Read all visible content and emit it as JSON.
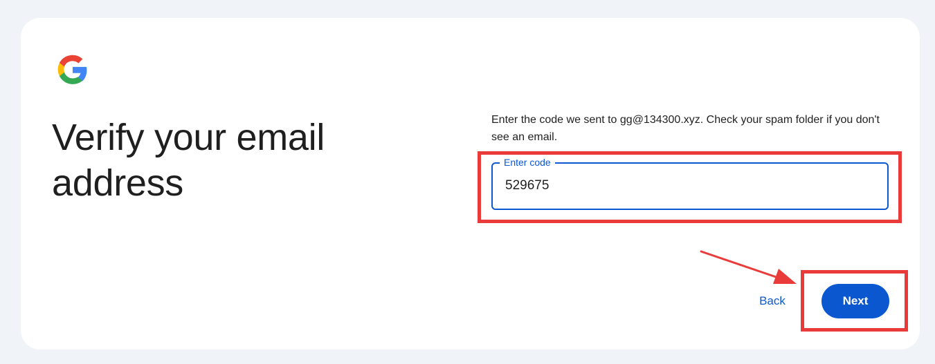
{
  "logo": {
    "icon": "google-g-icon",
    "colors": {
      "blue": "#4285F4",
      "red": "#EA4335",
      "yellow": "#FBBC05",
      "green": "#34A853"
    }
  },
  "page": {
    "title": "Verify your email address"
  },
  "instructions": "Enter the code we sent to gg@134300.xyz. Check your spam folder if you don't see an email.",
  "code_field": {
    "label": "Enter code",
    "value": "529675"
  },
  "actions": {
    "back_label": "Back",
    "next_label": "Next"
  },
  "theme": {
    "accent": "#0b57d0",
    "background": "#f0f4f9",
    "annotation": "#ea3b3b"
  }
}
